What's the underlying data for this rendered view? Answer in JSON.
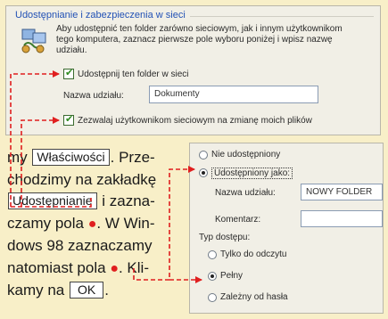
{
  "share_panel": {
    "title": "Udostępnianie i zabezpieczenia w sieci",
    "line1": "Aby udostępnić ten folder zarówno sieciowym, jak i innym użytkownikom",
    "line2": "tego komputera, zaznacz pierwsze pole wyboru poniżej i wpisz nazwę",
    "line3": "udziału.",
    "share_checkbox_label": "Udostępnij ten folder w sieci",
    "share_name_label": "Nazwa udziału:",
    "share_name_value": "Dokumenty",
    "allow_change_checkbox_label": "Zezwalaj użytkownikom sieciowym na zmianę moich plików"
  },
  "instruction": {
    "p1": "my",
    "btn_properties": "Właściwości",
    "p2": ". Prze-",
    "p3": "chodzimy na zakładkę",
    "tab_sharing": "Udostępnianie",
    "p4": " i zazna-",
    "p5": "czamy pola",
    "p6": ". W Win-",
    "p7": "dows 98 zaznaczamy",
    "p8": "natomiast pola",
    "p9": ". Kli-",
    "p10": "kamy na",
    "btn_ok": "OK",
    "p11": "."
  },
  "win98_panel": {
    "not_shared_label": "Nie udostępniony",
    "shared_as_label": "Udostępniony jako:",
    "share_name_label": "Nazwa udziału:",
    "share_name_value": "NOWY FOLDER",
    "comment_label": "Komentarz:",
    "comment_value": "",
    "access_type_label": "Typ dostępu:",
    "access_readonly": "Tylko do odczytu",
    "access_full": "Pełny",
    "access_password": "Zależny od hasła"
  },
  "colors": {
    "background": "#f8efc8",
    "arrow_red": "#e01f1f",
    "title_blue": "#2251b5"
  }
}
